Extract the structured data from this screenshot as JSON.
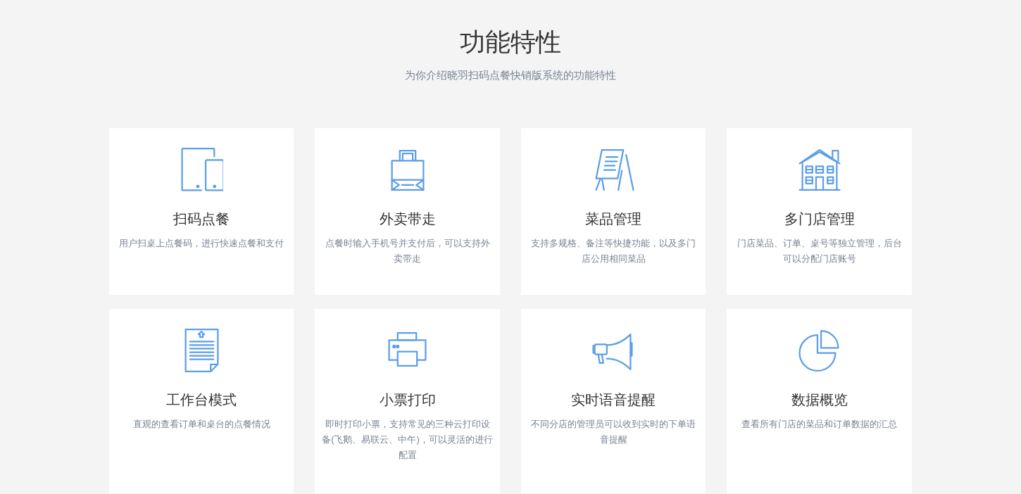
{
  "header": {
    "title": "功能特性",
    "subtitle": "为你介绍晓羽扫码点餐快销版系统的功能特性"
  },
  "features": [
    {
      "kind": "devices",
      "title": "扫码点餐",
      "description": "用户扫桌上点餐码，进行快速点餐和支付"
    },
    {
      "kind": "bag",
      "title": "外卖带走",
      "description": "点餐时输入手机号并支付后，可以支持外卖带走"
    },
    {
      "kind": "easel",
      "title": "菜品管理",
      "description": "支持多规格、备注等快捷功能，以及多门店公用相同菜品"
    },
    {
      "kind": "house",
      "title": "多门店管理",
      "description": "门店菜品、订单、桌号等独立管理，后台可以分配门店账号"
    },
    {
      "kind": "document",
      "title": "工作台模式",
      "description": "直观的查看订单和桌台的点餐情况"
    },
    {
      "kind": "printer",
      "title": "小票打印",
      "description": "即时打印小票，支持常见的三种云打印设备(飞鹅、易联云、中午)，可以灵活的进行配置"
    },
    {
      "kind": "megaphone",
      "title": "实时语音提醒",
      "description": "不同分店的管理员可以收到实时的下单语音提醒"
    },
    {
      "kind": "pie",
      "title": "数据概览",
      "description": "查看所有门店的菜品和订单数据的汇总"
    }
  ]
}
